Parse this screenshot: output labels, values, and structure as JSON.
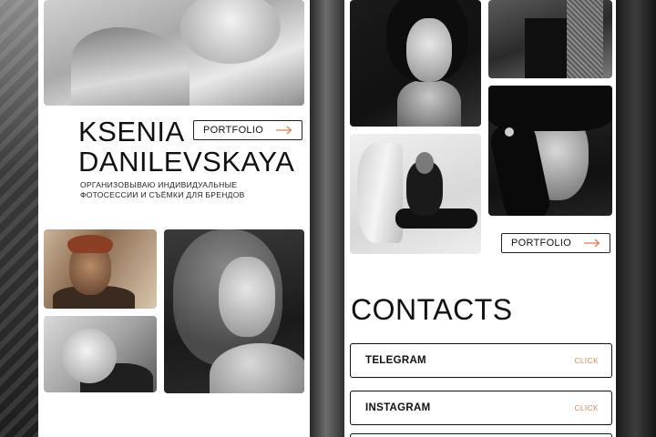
{
  "profile": {
    "name_line1": "KSENIA",
    "name_line2": "DANILEVSKAYA",
    "tagline_line1": "ОРГАНИЗОВЫВАЮ ИНДИВИДУАЛЬНЫЕ",
    "tagline_line2": "ФОТОСЕССИИ И СЪЁМКИ ДЛЯ БРЕНДОВ"
  },
  "buttons": {
    "portfolio_left": "PORTFOLIO",
    "portfolio_right": "PORTFOLIO"
  },
  "contacts": {
    "title": "CONTACTS",
    "items": [
      {
        "label": "TELEGRAM",
        "action": "CLICK"
      },
      {
        "label": "INSTAGRAM",
        "action": "CLICK"
      }
    ]
  },
  "colors": {
    "accent": "#e6824a",
    "text": "#111111",
    "panel": "#ffffff"
  },
  "icons": {
    "portfolio_arrow": "arrow-right-icon"
  }
}
